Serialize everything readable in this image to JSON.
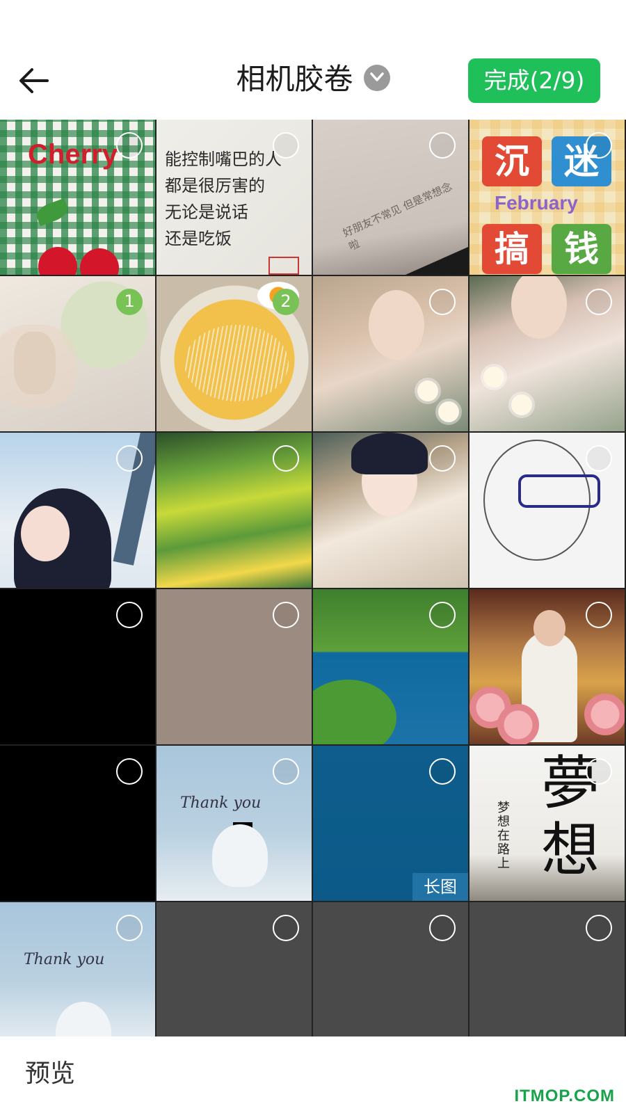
{
  "header": {
    "title": "相机胶卷",
    "done_label": "完成(2/9)"
  },
  "grid": {
    "thumbs": [
      {
        "kind": "cherry",
        "text": "Cherry",
        "selected_index": ""
      },
      {
        "kind": "quote",
        "text": "能控制嘴巴的人\n都是很厉害的\n无论是说话\n还是吃饭",
        "selected_index": ""
      },
      {
        "kind": "paper",
        "text": "好朋友不常见 但是常想念啦",
        "selected_index": ""
      },
      {
        "kind": "february",
        "text": "February",
        "tiles": [
          "沉",
          "迷",
          "搞",
          "钱"
        ],
        "selected_index": ""
      },
      {
        "kind": "matcha",
        "selected_index": "1"
      },
      {
        "kind": "noodle",
        "selected_index": "2"
      },
      {
        "kind": "woman1",
        "selected_index": ""
      },
      {
        "kind": "woman2",
        "selected_index": ""
      },
      {
        "kind": "anime1",
        "selected_index": ""
      },
      {
        "kind": "field",
        "selected_index": ""
      },
      {
        "kind": "anime2",
        "selected_index": ""
      },
      {
        "kind": "sketch",
        "selected_index": ""
      },
      {
        "kind": "black",
        "selected_index": ""
      },
      {
        "kind": "taupe",
        "selected_index": ""
      },
      {
        "kind": "greenblue",
        "selected_index": ""
      },
      {
        "kind": "rose",
        "selected_index": ""
      },
      {
        "kind": "black",
        "selected_index": ""
      },
      {
        "kind": "thank",
        "text": "Thank you",
        "selected_index": ""
      },
      {
        "kind": "blue",
        "badge": "长图",
        "selected_index": ""
      },
      {
        "kind": "dream",
        "text_big": "夢想",
        "text_small": "梦想在路上",
        "selected_index": ""
      },
      {
        "kind": "thank",
        "text": "Thank you",
        "selected_index": ""
      },
      {
        "kind": "grey",
        "selected_index": ""
      },
      {
        "kind": "grey",
        "selected_index": ""
      },
      {
        "kind": "grey",
        "selected_index": ""
      }
    ]
  },
  "footer": {
    "preview_label": "预览",
    "watermark": "ITMOP.COM"
  },
  "colors": {
    "accent": "#1fbf5a",
    "selected": "#79c255"
  },
  "icons": {
    "back": "arrow-left-icon",
    "dropdown": "chevron-down-icon",
    "select": "circle-checkbox-icon"
  }
}
